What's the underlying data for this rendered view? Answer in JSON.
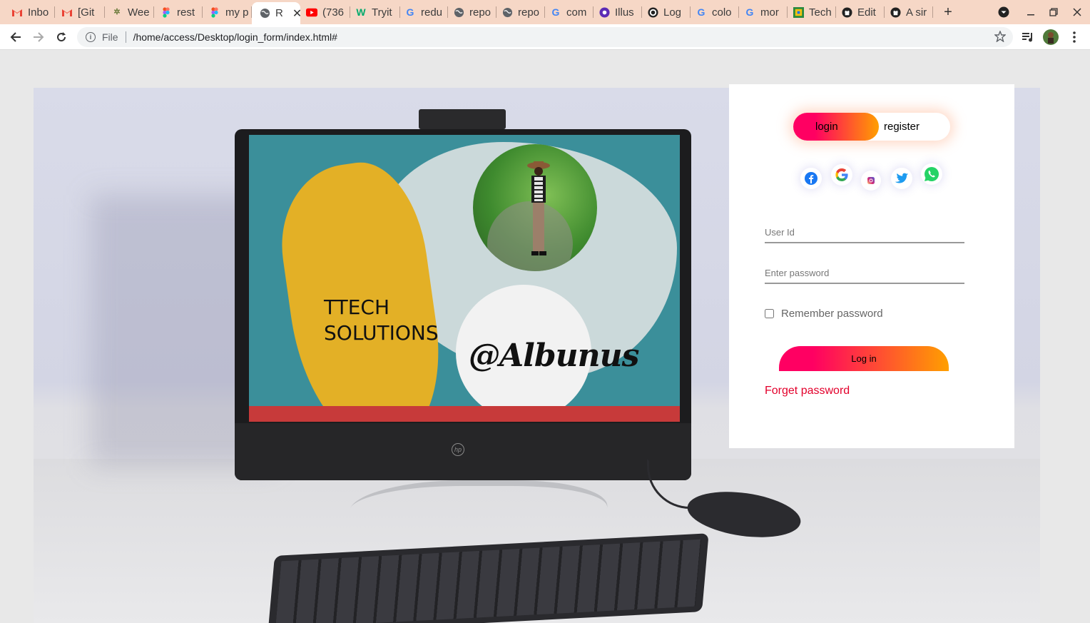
{
  "browser": {
    "tabs": [
      {
        "label": "Inbo",
        "icon": "gmail-icon"
      },
      {
        "label": "[Git",
        "icon": "gmail-icon"
      },
      {
        "label": "Wee",
        "icon": "palm-tree-icon"
      },
      {
        "label": "rest",
        "icon": "figma-icon"
      },
      {
        "label": "my p",
        "icon": "figma-icon"
      },
      {
        "label": "R",
        "icon": "globe-icon",
        "active": true
      },
      {
        "label": "(736",
        "icon": "youtube-icon"
      },
      {
        "label": "Tryit",
        "icon": "w3schools-icon"
      },
      {
        "label": "redu",
        "icon": "google-icon"
      },
      {
        "label": "repo",
        "icon": "globe-icon"
      },
      {
        "label": "repo",
        "icon": "globe-icon"
      },
      {
        "label": "com",
        "icon": "google-icon"
      },
      {
        "label": "Illus",
        "icon": "illustration-icon"
      },
      {
        "label": "Log",
        "icon": "logo-icon"
      },
      {
        "label": "colo",
        "icon": "google-icon"
      },
      {
        "label": "mor",
        "icon": "google-icon"
      },
      {
        "label": "Tech",
        "icon": "tech-icon"
      },
      {
        "label": "Edit",
        "icon": "github-icon"
      },
      {
        "label": "A sir",
        "icon": "github-icon"
      }
    ],
    "new_tab": "+",
    "tab_close": "✕",
    "address": {
      "scheme_label": "File",
      "url": "/home/access/Desktop/login_form/index.html#"
    }
  },
  "hero": {
    "brand_line1": "TTECH",
    "brand_line2": "SOLUTIONS",
    "signature": "@Albunus"
  },
  "auth": {
    "toggle": {
      "login": "login",
      "register": "register",
      "active": "login"
    },
    "socials": [
      "facebook-icon",
      "google-icon",
      "instagram-icon",
      "twitter-icon",
      "whatsapp-icon"
    ],
    "user_id_placeholder": "User Id",
    "password_placeholder": "Enter password",
    "remember_label": "Remember password",
    "remember_checked": false,
    "login_button": "Log in",
    "forgot_link": "Forget password"
  },
  "colors": {
    "gradient_start": "#ff0062",
    "gradient_end": "#ff9f00",
    "forgot_link": "#e3002b",
    "tabbar": "#f6d7c6"
  }
}
